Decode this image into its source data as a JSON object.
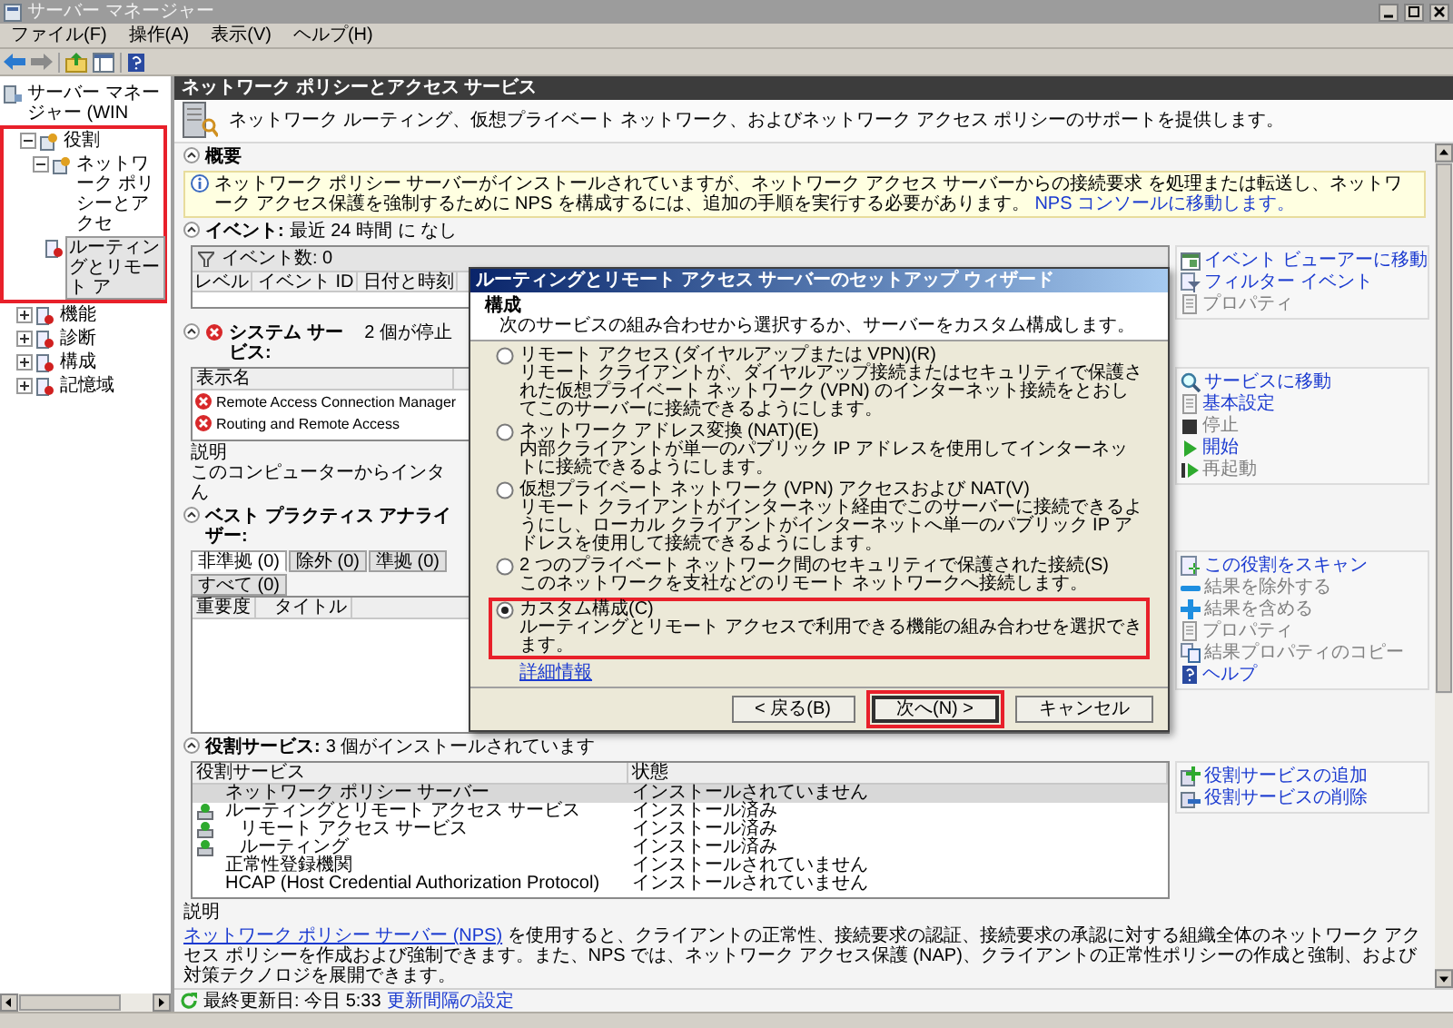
{
  "window": {
    "title": "サーバー マネージャー"
  },
  "menu": [
    "ファイル(F)",
    "操作(A)",
    "表示(V)",
    "ヘルプ(H)"
  ],
  "tree": {
    "label": "サーバー マネージャー (WIN",
    "selected": false,
    "highlighted": false,
    "children": [
      {
        "label": "役割",
        "expanded": true,
        "selected": false,
        "highlighted": true,
        "children": [
          {
            "label": "ネットワーク ポリシーとアクセ",
            "expanded": true,
            "selected": false,
            "highlighted": false,
            "children": [
              {
                "label": "ルーティングとリモート ア",
                "selected": true,
                "highlighted": false
              }
            ]
          }
        ]
      },
      {
        "label": "機能",
        "expanded": false,
        "selected": false,
        "highlighted": false
      },
      {
        "label": "診断",
        "expanded": false,
        "selected": false,
        "highlighted": false
      },
      {
        "label": "構成",
        "expanded": false,
        "selected": false,
        "highlighted": false
      },
      {
        "label": "記憶域",
        "expanded": false,
        "selected": false,
        "highlighted": false
      }
    ]
  },
  "content": {
    "title": "ネットワーク ポリシーとアクセス サービス",
    "description": "ネットワーク ルーティング、仮想プライベート ネットワーク、およびネットワーク アクセス ポリシーのサポートを提供します。"
  },
  "overview": {
    "title": "概要",
    "info": "ネットワーク ポリシー サーバーがインストールされていますが、ネットワーク アクセス サーバーからの接続要求 を処理または転送し、ネットワーク アクセス保護を強制するために NPS を構成するには、追加の手順を実行する必要があります。",
    "link": "NPS コンソールに移動します。"
  },
  "events": {
    "title": "イベント:",
    "summary": "最近 24 時間 に なし",
    "filter": "イベント数: 0",
    "columns": [
      "レベル",
      "イベント ID",
      "日付と時刻"
    ],
    "actions": [
      {
        "label": "イベント ビューアーに移動",
        "disabled": false
      },
      {
        "label": "フィルター イベント",
        "disabled": false
      },
      {
        "label": "プロパティ",
        "disabled": true
      }
    ]
  },
  "services": {
    "title": "システム サービス:",
    "summary": "2 個が停止",
    "alert": true,
    "columns": [
      "表示名"
    ],
    "rows": [
      {
        "name": "Remote Access Connection Manager",
        "stopped": true
      },
      {
        "name": "Routing and Remote Access",
        "stopped": true
      }
    ],
    "description_label": "説明",
    "description": [
      "このコンピューターからインタ",
      "ん"
    ],
    "actions": [
      {
        "label": "サービスに移動",
        "disabled": false
      },
      {
        "label": "基本設定",
        "disabled": false
      },
      {
        "label": "停止",
        "disabled": true
      },
      {
        "label": "開始",
        "disabled": false
      },
      {
        "label": "再起動",
        "disabled": true
      }
    ]
  },
  "bpa": {
    "title": "ベスト プラクティス アナライザー:",
    "tabs": [
      {
        "label": "非準拠 (0)",
        "selected": true
      },
      {
        "label": "除外 (0)",
        "selected": false
      },
      {
        "label": "準拠 (0)",
        "selected": false
      },
      {
        "label": "すべて (0)",
        "selected": false
      }
    ],
    "columns": [
      "重要度",
      "タイトル"
    ],
    "actions": [
      {
        "label": "この役割をスキャン",
        "disabled": false
      },
      {
        "label": "結果を除外する",
        "disabled": true
      },
      {
        "label": "結果を含める",
        "disabled": true
      },
      {
        "label": "プロパティ",
        "disabled": true
      },
      {
        "label": "結果プロパティのコピー",
        "disabled": true
      },
      {
        "label": "ヘルプ",
        "disabled": false
      }
    ]
  },
  "role_services": {
    "title": "役割サービス:",
    "summary": "3 個がインストールされています",
    "columns": [
      "役割サービス",
      "状態"
    ],
    "rows": [
      {
        "name": "ネットワーク ポリシー サーバー",
        "status": "インストールされていません",
        "installed": false,
        "selected": true
      },
      {
        "name": "ルーティングとリモート アクセス サービス",
        "status": "インストール済み",
        "installed": true,
        "selected": false,
        "children": [
          {
            "name": "リモート アクセス サービス",
            "status": "インストール済み",
            "installed": true,
            "selected": false
          },
          {
            "name": "ルーティング",
            "status": "インストール済み",
            "installed": true,
            "selected": false
          }
        ]
      },
      {
        "name": "正常性登録機関",
        "status": "インストールされていません",
        "installed": false,
        "selected": false
      },
      {
        "name": "HCAP (Host Credential Authorization Protocol)",
        "status": "インストールされていません",
        "installed": false,
        "selected": false
      }
    ],
    "description_label": "説明",
    "description_link": "ネットワーク ポリシー サーバー (NPS)",
    "description": "を使用すると、クライアントの正常性、接続要求の認証、接続要求の承認に対する組織全体のネットワーク アクセス ポリシーを作成および強制できます。また、NPS では、ネットワーク アクセス保護 (NAP)、クライアントの正常性ポリシーの作成と強制、および対策テクノロジを展開できます。",
    "actions": [
      {
        "label": "役割サービスの追加",
        "disabled": false
      },
      {
        "label": "役割サービスの削除",
        "disabled": false
      }
    ]
  },
  "footer": {
    "updated": "最終更新日: 今日 5:33",
    "link": "更新間隔の設定"
  },
  "dialog": {
    "title": "ルーティングとリモート アクセス サーバーのセットアップ ウィザード",
    "heading": "構成",
    "subheading": "次のサービスの組み合わせから選択するか、サーバーをカスタム構成します。",
    "options": [
      {
        "label": "リモート アクセス (ダイヤルアップまたは VPN)(R)",
        "description": "リモート クライアントが、ダイヤルアップ接続またはセキュリティで保護された仮想プライベート ネットワーク (VPN) のインターネット接続をとおしてこのサーバーに接続できるようにします。",
        "selected": false,
        "highlighted": false
      },
      {
        "label": "ネットワーク アドレス変換 (NAT)(E)",
        "description": "内部クライアントが単一のパブリック IP アドレスを使用してインターネットに接続できるようにします。",
        "selected": false,
        "highlighted": false
      },
      {
        "label": "仮想プライベート ネットワーク (VPN) アクセスおよび NAT(V)",
        "description": "リモート クライアントがインターネット経由でこのサーバーに接続できるようにし、ローカル クライアントがインターネットへ単一のパブリック IP アドレスを使用して接続できるようにします。",
        "selected": false,
        "highlighted": false
      },
      {
        "label": "2 つのプライベート ネットワーク間のセキュリティで保護された接続(S)",
        "description": "このネットワークを支社などのリモート ネットワークへ接続します。",
        "selected": false,
        "highlighted": false
      },
      {
        "label": "カスタム構成(C)",
        "description": "ルーティングとリモート アクセスで利用できる機能の組み合わせを選択できます。",
        "selected": true,
        "highlighted": true
      }
    ],
    "link": "詳細情報",
    "buttons": [
      {
        "label": "< 戻る(B)",
        "default": false,
        "highlighted": false
      },
      {
        "label": "次へ(N) >",
        "default": true,
        "highlighted": true
      },
      {
        "label": "キャンセル",
        "default": false,
        "highlighted": false
      }
    ]
  }
}
